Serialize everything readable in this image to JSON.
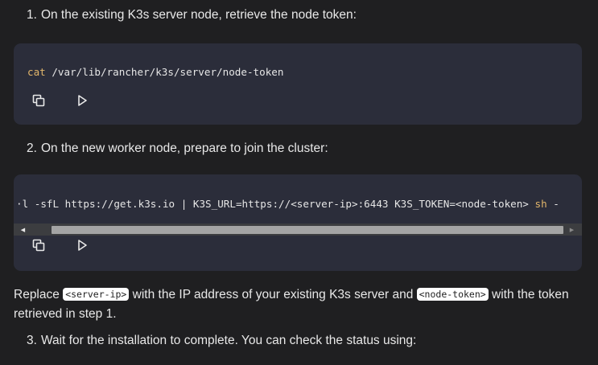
{
  "steps": [
    {
      "num": "1.",
      "text": "On the existing K3s server node, retrieve the node token:"
    },
    {
      "num": "2.",
      "text": "On the new worker node, prepare to join the cluster:"
    },
    {
      "num": "3.",
      "text": "Wait for the installation to complete. You can check the status using:"
    }
  ],
  "code_blocks": [
    {
      "keyword": "cat",
      "rest": " /var/lib/rancher/k3s/server/node-token"
    },
    {
      "visible_text": "·l -sfL https://get.k3s.io | K3S_URL=https://<server-ip>:6443 K3S_TOKEN=<node-token> sh -",
      "keyword": "sh",
      "prefix": "·l -sfL https://get.k3s.io | K3S_URL=https://<server-ip>:6443 K3S_TOKEN=<node-token> ",
      "suffix": " -"
    }
  ],
  "actions": {
    "copy_icon": "copy-icon",
    "run_icon": "play-icon"
  },
  "note": {
    "part1": "Replace ",
    "code1": "<server-ip>",
    "part2": " with the IP address of your existing K3s server and ",
    "code2": "<node-token>",
    "part3": " with the token retrieved in step 1."
  },
  "colors": {
    "background": "#1f1f21",
    "code_background": "#2b2d3a",
    "keyword": "#e2b66b"
  }
}
